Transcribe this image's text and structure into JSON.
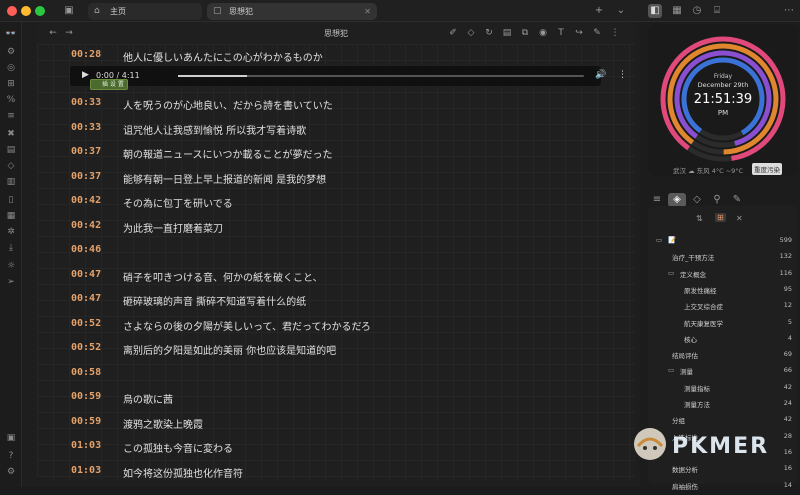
{
  "tabs": [
    {
      "label": "主页",
      "icon": "home-icon"
    },
    {
      "label": "思想犯",
      "icon": "file-icon"
    }
  ],
  "editor": {
    "title": "思想犯"
  },
  "audio": {
    "time": "0:00 / 4:11",
    "progress": 0.17
  },
  "tooltip": "插 设 置",
  "lyrics": [
    {
      "t": "00:28",
      "text": "他人に優しいあんたにこの心がわかるものか"
    },
    {
      "t": "00:33",
      "text": "人を呪うのが心地良い、だから詩を書いていた"
    },
    {
      "t": "00:33",
      "text": "诅咒他人让我感到愉悦  所以我才写着诗歌"
    },
    {
      "t": "00:37",
      "text": "朝の報道ニュースにいつか載ることが夢だった"
    },
    {
      "t": "00:37",
      "text": "能够有朝一日登上早上报道的新闻  是我的梦想"
    },
    {
      "t": "00:42",
      "text": "その為に包丁を研いでる"
    },
    {
      "t": "00:42",
      "text": "为此我一直打磨着菜刀"
    },
    {
      "t": "00:46",
      "text": ""
    },
    {
      "t": "00:47",
      "text": "硝子を叩きつける音、何かの紙を破くこと、"
    },
    {
      "t": "00:47",
      "text": "砸碎玻璃的声音  撕碎不知道写着什么的纸"
    },
    {
      "t": "00:52",
      "text": "さよならの後の夕陽が美しいって、君だってわかるだろ"
    },
    {
      "t": "00:52",
      "text": "离别后的夕阳是如此的美丽  你也应该是知道的吧"
    },
    {
      "t": "00:58",
      "text": ""
    },
    {
      "t": "00:59",
      "text": "烏の歌に茜"
    },
    {
      "t": "00:59",
      "text": "渡鸦之歌染上晚霞"
    },
    {
      "t": "01:03",
      "text": "この孤独も今音に変わる"
    },
    {
      "t": "01:03",
      "text": "如今将这份孤独也化作音符"
    }
  ],
  "clock": {
    "day": "Friday",
    "date": "December 29th",
    "time": "21:51:39",
    "ampm": "PM",
    "weather": "武汉 ☁ 东风 4°C ~9°C",
    "badge": "重度污染",
    "colors": [
      "#e0497a",
      "#e0862f",
      "#8a4fd0",
      "#3a72d8"
    ]
  },
  "tree": [
    {
      "label": "📝",
      "count": "599",
      "indent": 0,
      "folder": true
    },
    {
      "label": "治疗_干预方法",
      "count": "132",
      "indent": 1,
      "folder": false
    },
    {
      "label": "定义概念",
      "count": "116",
      "indent": 1,
      "folder": true
    },
    {
      "label": "原发性痛经",
      "count": "95",
      "indent": 2,
      "folder": false
    },
    {
      "label": "上交叉综合症",
      "count": "12",
      "indent": 2,
      "folder": false
    },
    {
      "label": "航天康复医学",
      "count": "5",
      "indent": 2,
      "folder": false
    },
    {
      "label": "核心",
      "count": "4",
      "indent": 2,
      "folder": false
    },
    {
      "label": "结局评估",
      "count": "69",
      "indent": 1,
      "folder": false
    },
    {
      "label": "测量",
      "count": "66",
      "indent": 1,
      "folder": true
    },
    {
      "label": "测量指标",
      "count": "42",
      "indent": 2,
      "folder": false
    },
    {
      "label": "测量方法",
      "count": "24",
      "indent": 2,
      "folder": false
    },
    {
      "label": "分组",
      "count": "42",
      "indent": 1,
      "folder": false
    },
    {
      "label": "入选标准",
      "count": "28",
      "indent": 1,
      "folder": false
    },
    {
      "label": "",
      "count": "16",
      "indent": 1,
      "folder": false
    },
    {
      "label": "数据分析",
      "count": "16",
      "indent": 1,
      "folder": false
    },
    {
      "label": "肩袖损伤",
      "count": "14",
      "indent": 1,
      "folder": false
    }
  ],
  "watermark": "PKMER"
}
